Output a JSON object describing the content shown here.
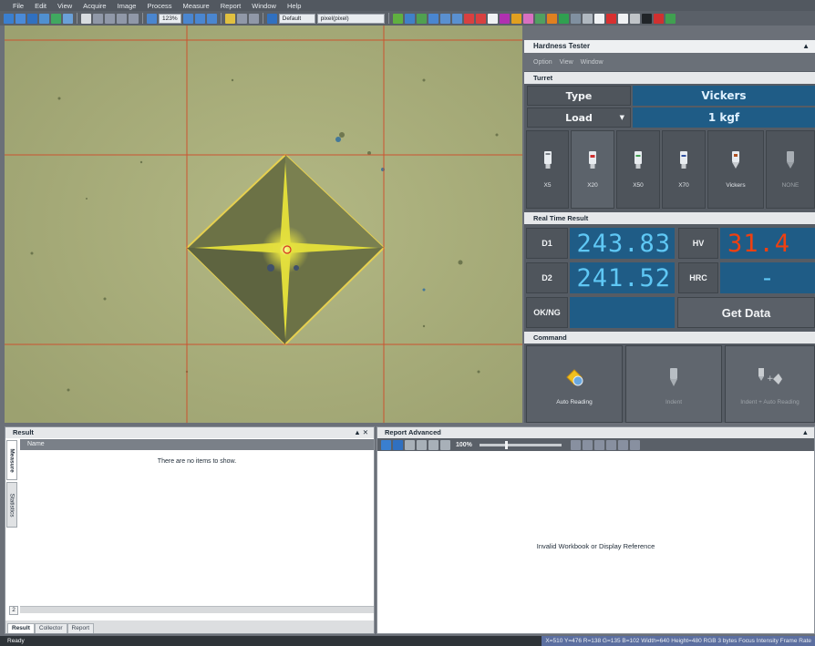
{
  "menu": [
    "File",
    "Edit",
    "View",
    "Acquire",
    "Image",
    "Process",
    "Measure",
    "Report",
    "Window",
    "Help"
  ],
  "toolbar": {
    "zoom": "123%",
    "profile": "Default",
    "unit": "pixel(pixel)"
  },
  "hardness_tester": {
    "title": "Hardness Tester",
    "menu": [
      "Option",
      "View",
      "Window"
    ],
    "turret_label": "Turret",
    "type_label": "Type",
    "type_value": "Vickers",
    "load_label": "Load",
    "load_value": "1 kgf",
    "lenses": [
      {
        "label": "X5",
        "state": "normal"
      },
      {
        "label": "X20",
        "state": "active"
      },
      {
        "label": "X50",
        "state": "normal"
      },
      {
        "label": "X70",
        "state": "normal"
      },
      {
        "label": "Vickers",
        "state": "normal"
      },
      {
        "label": "NONE",
        "state": "disabled"
      }
    ],
    "realtime_label": "Real Time Result",
    "d1_label": "D1",
    "d1_value": "243.83",
    "d2_label": "D2",
    "d2_value": "241.52",
    "hv_label": "HV",
    "hv_value": "31.4",
    "hrc_label": "HRC",
    "hrc_value": "-",
    "okng_label": "OK/NG",
    "getdata_label": "Get Data",
    "command_label": "Command",
    "commands": [
      {
        "label": "Auto Reading",
        "enabled": true
      },
      {
        "label": "Indent",
        "enabled": false
      },
      {
        "label": "Indent + Auto Reading",
        "enabled": false
      }
    ]
  },
  "result_panel": {
    "title": "Result",
    "vertical_tabs": [
      "Measure",
      "Statistics"
    ],
    "column_name": "Name",
    "empty_text": "There are no items to show.",
    "page_number": "2",
    "bottom_tabs": [
      "Result",
      "Collector",
      "Report"
    ]
  },
  "report_panel": {
    "title": "Report Advanced",
    "zoom": "100%",
    "message": "Invalid Workbook or Display Reference"
  },
  "status": {
    "ready": "Ready",
    "info": "X=510 Y=476   R=138 G=135 B=102   Width=640 Height=480   RGB 3 bytes   Focus   Intensity   Frame Rate"
  },
  "icons": {
    "main_toolbar": [
      "save-icon",
      "open-icon",
      "zoom-icon",
      "grid-icon",
      "measure-icon"
    ],
    "lens": "objective-lens-icon",
    "auto_reading": "auto-reading-icon",
    "indent": "indenter-icon"
  }
}
